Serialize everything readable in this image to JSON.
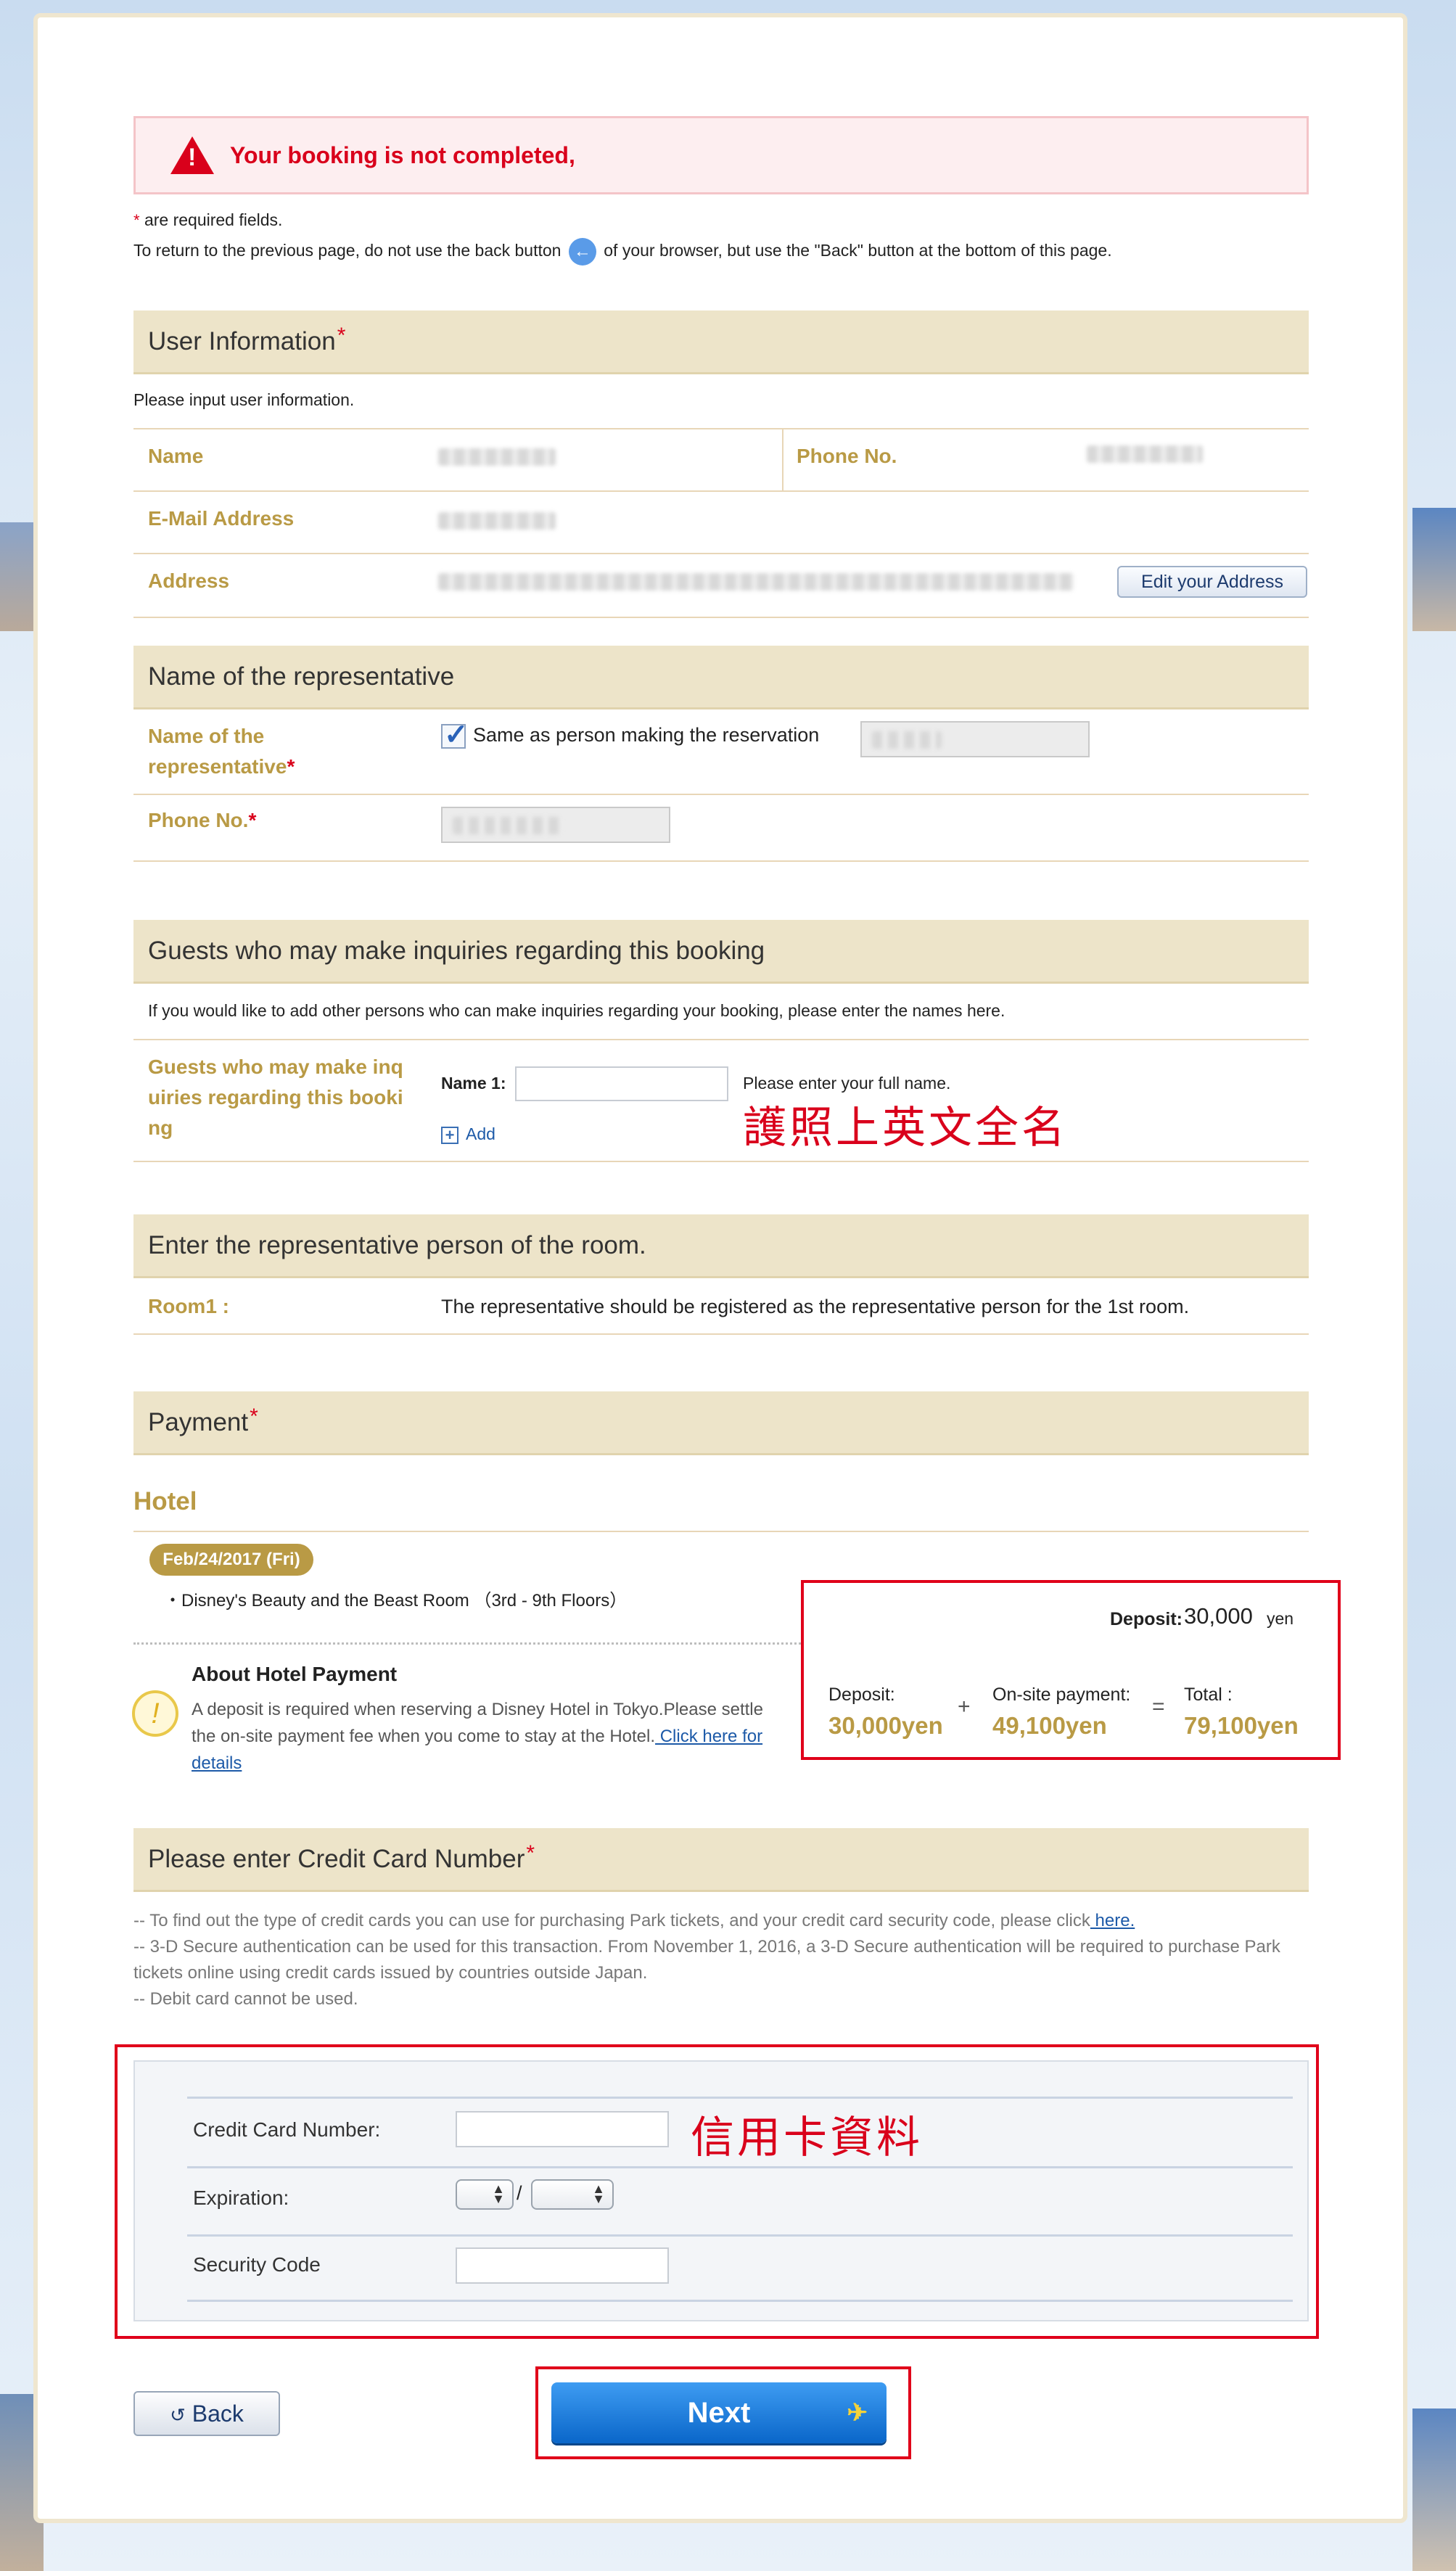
{
  "error": {
    "message": "Your booking is not completed,"
  },
  "notes": {
    "required_text": "are required fields.",
    "back_prefix": "To return to the previous page, do not use the back button",
    "back_suffix": "of your browser, but use the \"Back\" button at the bottom of this page."
  },
  "user_info": {
    "heading": "User Information",
    "intro": "Please input user information.",
    "name_label": "Name",
    "phone_label": "Phone No.",
    "email_label": "E-Mail Address",
    "address_label": "Address",
    "edit_address_button": "Edit your Address"
  },
  "representative": {
    "heading": "Name of the representative",
    "name_label_1": "Name of the",
    "name_label_2": "representative",
    "same_as_text": "Same as person making the reservation",
    "phone_label": "Phone No."
  },
  "guests": {
    "heading": "Guests who may make inquiries regarding this booking",
    "intro": "If you would like to add other persons who can make inquiries regarding your booking, please enter the names here.",
    "label_1": "Guests who may make inq",
    "label_2": "uiries regarding this booki",
    "label_3": "ng",
    "name1_label": "Name 1:",
    "name1_hint": "Please enter your full name.",
    "add_label": "Add",
    "annotation": "護照上英文全名"
  },
  "room": {
    "heading": "Enter the representative person of the room.",
    "room_label": "Room1 :",
    "room_text": "The representative should be registered as the representative person for the 1st room."
  },
  "payment": {
    "heading": "Payment",
    "hotel_title": "Hotel",
    "date": "Feb/24/2017 (Fri)",
    "room_name": "・Disney's Beauty and the Beast Room （3rd - 9th Floors）",
    "deposit_line_label": "Deposit:",
    "deposit_line_value": "30,000",
    "deposit_line_unit": "yen",
    "about_title": "About Hotel Payment",
    "about_body": "A deposit is required when reserving a Disney Hotel in Tokyo.Please settle the on-site payment fee when you come to stay at the Hotel.",
    "about_link": " Click here for details",
    "deposit_label": "Deposit:",
    "deposit_value": "30,000yen",
    "onsite_label": "On-site payment:",
    "onsite_value": "49,100yen",
    "total_label": "Total :",
    "total_value": "79,100yen",
    "plus": "+",
    "equals": "="
  },
  "credit_card": {
    "heading": "Please enter Credit Card Number",
    "note1_prefix": "-- To find out the type of credit cards you can use for purchasing Park tickets, and your credit card security code, please click",
    "note1_link": " here.",
    "note2": "-- 3-D Secure authentication can be used for this transaction. From November 1, 2016, a 3-D Secure authentication will be required to purchase Park tickets online using credit cards issued by countries outside Japan.",
    "note3": "-- Debit card cannot be used.",
    "number_label": "Credit Card Number:",
    "expiration_label": "Expiration:",
    "slash": "/",
    "security_label": "Security Code",
    "annotation": "信用卡資料"
  },
  "nav": {
    "back_label": "Back",
    "next_label": "Next"
  },
  "colors": {
    "gold": "#b99a45",
    "error_red": "#d9001b",
    "section_bg": "#ede4c9",
    "next_blue": "#0a66c9"
  }
}
